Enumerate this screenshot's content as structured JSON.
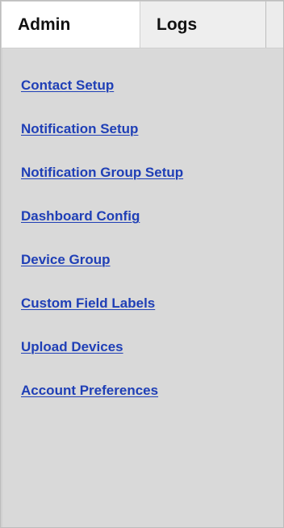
{
  "tabs": {
    "admin": "Admin",
    "logs": "Logs"
  },
  "menu": [
    {
      "label": "Contact Setup"
    },
    {
      "label": "Notification Setup"
    },
    {
      "label": "Notification Group Setup"
    },
    {
      "label": "Dashboard Config"
    },
    {
      "label": "Device Group"
    },
    {
      "label": "Custom Field Labels"
    },
    {
      "label": "Upload Devices"
    },
    {
      "label": "Account Preferences"
    }
  ],
  "colors": {
    "link": "#1f3fb6",
    "active_tab": "#ffffff",
    "inactive_tab": "#eeeeee",
    "panel": "#d9d9d9"
  }
}
